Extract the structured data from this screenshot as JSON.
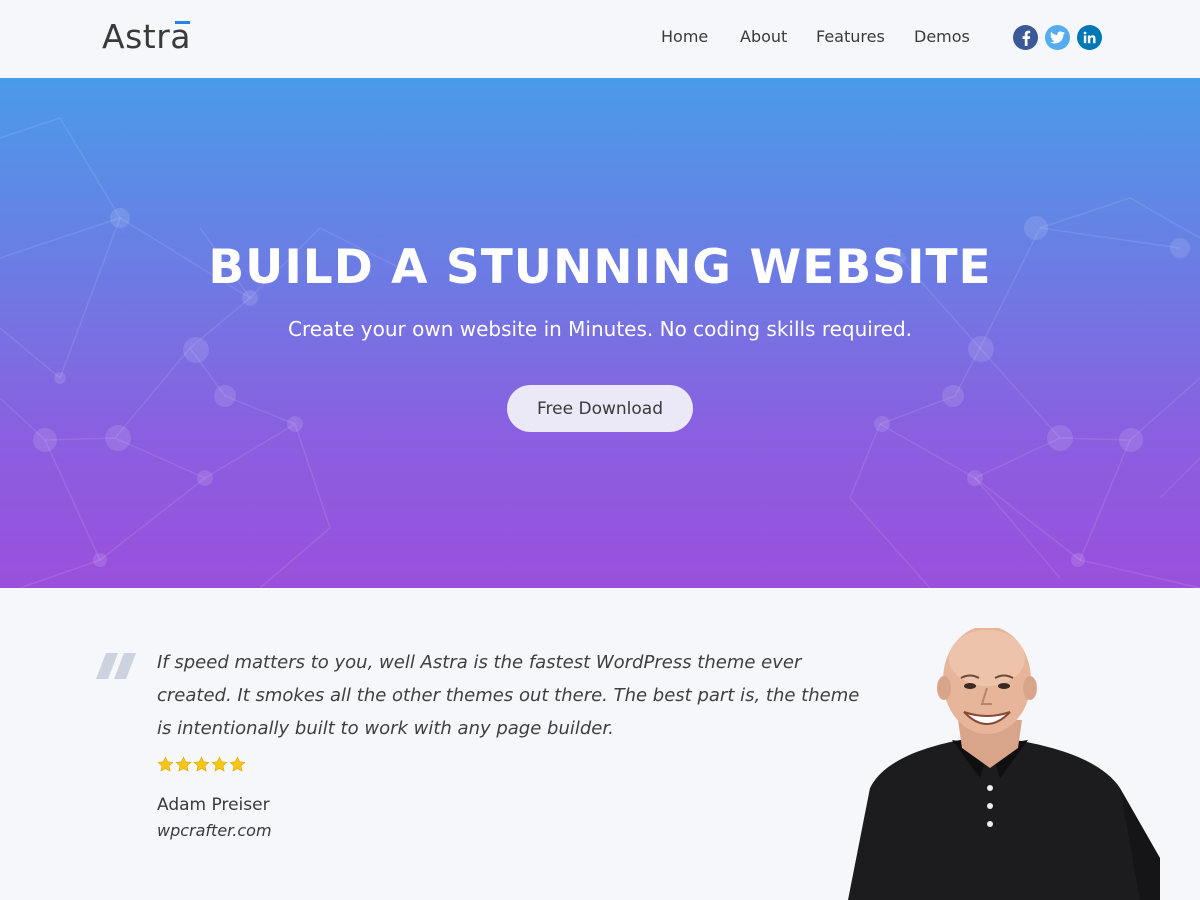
{
  "header": {
    "logo": "Astra",
    "nav": [
      {
        "label": "Home"
      },
      {
        "label": "About"
      },
      {
        "label": "Features"
      },
      {
        "label": "Demos"
      }
    ],
    "social": [
      {
        "icon": "facebook-icon",
        "glyph": "f",
        "color": "#3b5998"
      },
      {
        "icon": "twitter-icon",
        "glyph": "bird",
        "color": "#55acee"
      },
      {
        "icon": "linkedin-icon",
        "glyph": "in",
        "color": "#0077b5"
      }
    ]
  },
  "hero": {
    "title": "BUILD A STUNNING WEBSITE",
    "subtitle": "Create your own website in Minutes. No coding skills required.",
    "button_label": "Free Download",
    "gradient_top": "#4a9be9",
    "gradient_bottom": "#9a50dc"
  },
  "testimonial": {
    "quote_icon": "quote-icon",
    "quote": "If speed matters to you, well Astra is the fastest WordPress theme ever created. It smokes all the other themes out there. The best part is, the theme is intentionally built to work with any page builder.",
    "rating": 5,
    "rating_max": 5,
    "star_color": "#f5c518",
    "author": "Adam Preiser",
    "site": "wpcrafter.com"
  }
}
